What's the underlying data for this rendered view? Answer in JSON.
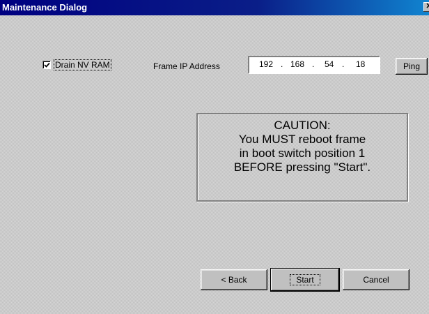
{
  "window": {
    "title": "Maintenance Dialog",
    "close_glyph": "✕"
  },
  "options": {
    "drain_nv_ram_label": "Drain NV RAM",
    "drain_nv_ram_checked": true
  },
  "ip": {
    "label": "Frame IP Address",
    "octet1": "192",
    "octet2": "168",
    "octet3": "54",
    "octet4": "18",
    "separator": "."
  },
  "buttons": {
    "ping": "Ping",
    "back": "< Back",
    "start": "Start",
    "cancel": "Cancel"
  },
  "caution": {
    "line1": "CAUTION:",
    "line2": "You MUST reboot frame",
    "line3": "in boot switch position 1",
    "line4": "BEFORE pressing \"Start\"."
  },
  "colors": {
    "titlebar": "#000080",
    "face": "#c0c0c0"
  }
}
